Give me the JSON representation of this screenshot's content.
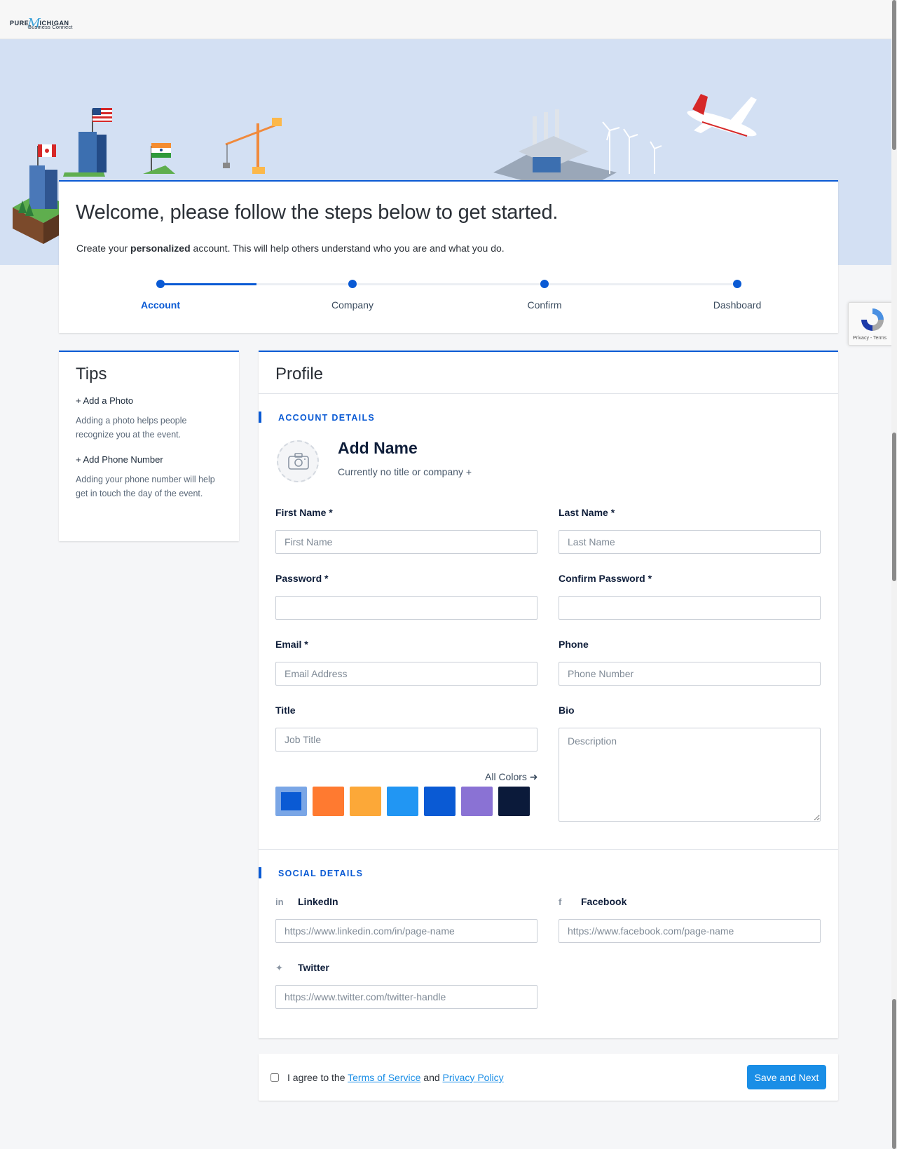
{
  "brand": {
    "logo_pure": "PURE",
    "logo_m": "M",
    "logo_ichigan": "ICHIGAN",
    "logo_sub": "Business Connect"
  },
  "welcome": {
    "heading": "Welcome, please follow the steps below to get started.",
    "intro_before": "Create your ",
    "intro_bold": "personalized",
    "intro_after": " account. This will help others understand who you are and what you do."
  },
  "steps": [
    {
      "label": "Account",
      "active": true
    },
    {
      "label": "Company",
      "active": false
    },
    {
      "label": "Confirm",
      "active": false
    },
    {
      "label": "Dashboard",
      "active": false
    }
  ],
  "progress_fraction": 0.167,
  "tips": {
    "title": "Tips",
    "items": [
      {
        "title": "+ Add a Photo",
        "body": "Adding a photo helps people recognize you at the event."
      },
      {
        "title": "+ Add Phone Number",
        "body": "Adding your phone number will help get in touch the day of the event."
      }
    ]
  },
  "profile": {
    "title": "Profile",
    "account_section": "ACCOUNT DETAILS",
    "name": "Add Name",
    "subline": "Currently no title or company +",
    "fields": {
      "first_name": {
        "label": "First Name *",
        "placeholder": "First Name",
        "value": ""
      },
      "last_name": {
        "label": "Last Name *",
        "placeholder": "Last Name",
        "value": ""
      },
      "password": {
        "label": "Password *",
        "placeholder": "",
        "value": ""
      },
      "confirm_password": {
        "label": "Confirm Password *",
        "placeholder": "",
        "value": ""
      },
      "email": {
        "label": "Email *",
        "placeholder": "Email Address",
        "value": ""
      },
      "phone": {
        "label": "Phone",
        "placeholder": "Phone Number",
        "value": ""
      },
      "title": {
        "label": "Title",
        "placeholder": "Job Title",
        "value": ""
      },
      "bio": {
        "label": "Bio",
        "placeholder": "Description",
        "value": ""
      }
    },
    "all_colors_label": "All Colors",
    "colors": [
      "#0a5ad4",
      "#ff7a30",
      "#fca838",
      "#2196f3",
      "#0a5ad4",
      "#8a72d4",
      "#0b1a3a"
    ],
    "selected_color_index": 0,
    "social_section": "SOCIAL DETAILS",
    "social": {
      "linkedin": {
        "label": "LinkedIn",
        "placeholder": "https://www.linkedin.com/in/page-name"
      },
      "facebook": {
        "label": "Facebook",
        "placeholder": "https://www.facebook.com/page-name"
      },
      "twitter": {
        "label": "Twitter",
        "placeholder": "https://www.twitter.com/twitter-handle"
      }
    }
  },
  "footer": {
    "agree_prefix": "I agree to the ",
    "terms_link": "Terms of Service",
    "and_text": " and ",
    "privacy_link": "Privacy Policy",
    "save_label": "Save and Next"
  },
  "recaptcha": {
    "text": "Privacy - Terms"
  },
  "colors": {
    "accent": "#0a5ad4",
    "button": "#1a8ee6",
    "hero_bg": "#d3e0f3"
  }
}
